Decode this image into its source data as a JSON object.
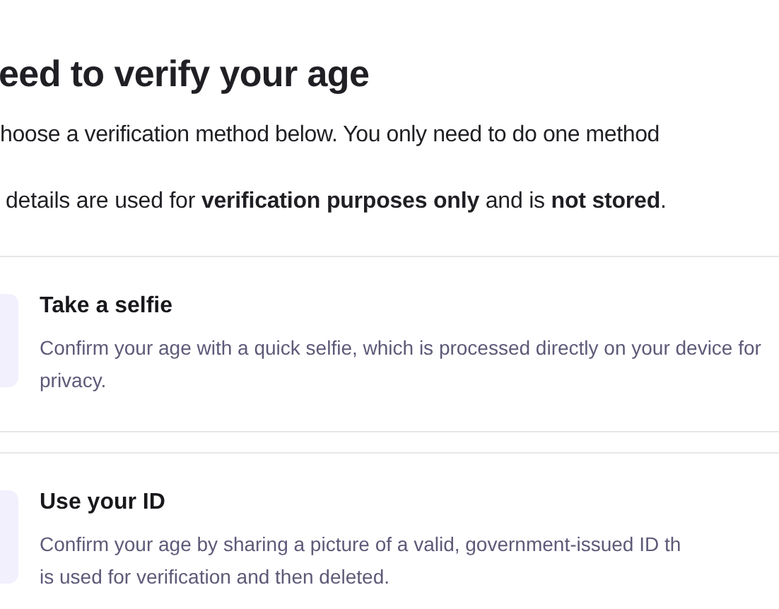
{
  "title": "eed to verify your age",
  "intro": "hoose a verification method below. You only need to do one method",
  "notice": "details are used for **verification purposes only** and is **not stored**.",
  "methods": [
    {
      "title": "Take a selfie",
      "description": "Confirm your age with a quick selfie, which is processed directly on your device for privacy."
    },
    {
      "title": "Use your ID",
      "description": "Confirm your age by sharing a picture of a valid, government-issued ID th\nis used for verification and then deleted."
    }
  ]
}
